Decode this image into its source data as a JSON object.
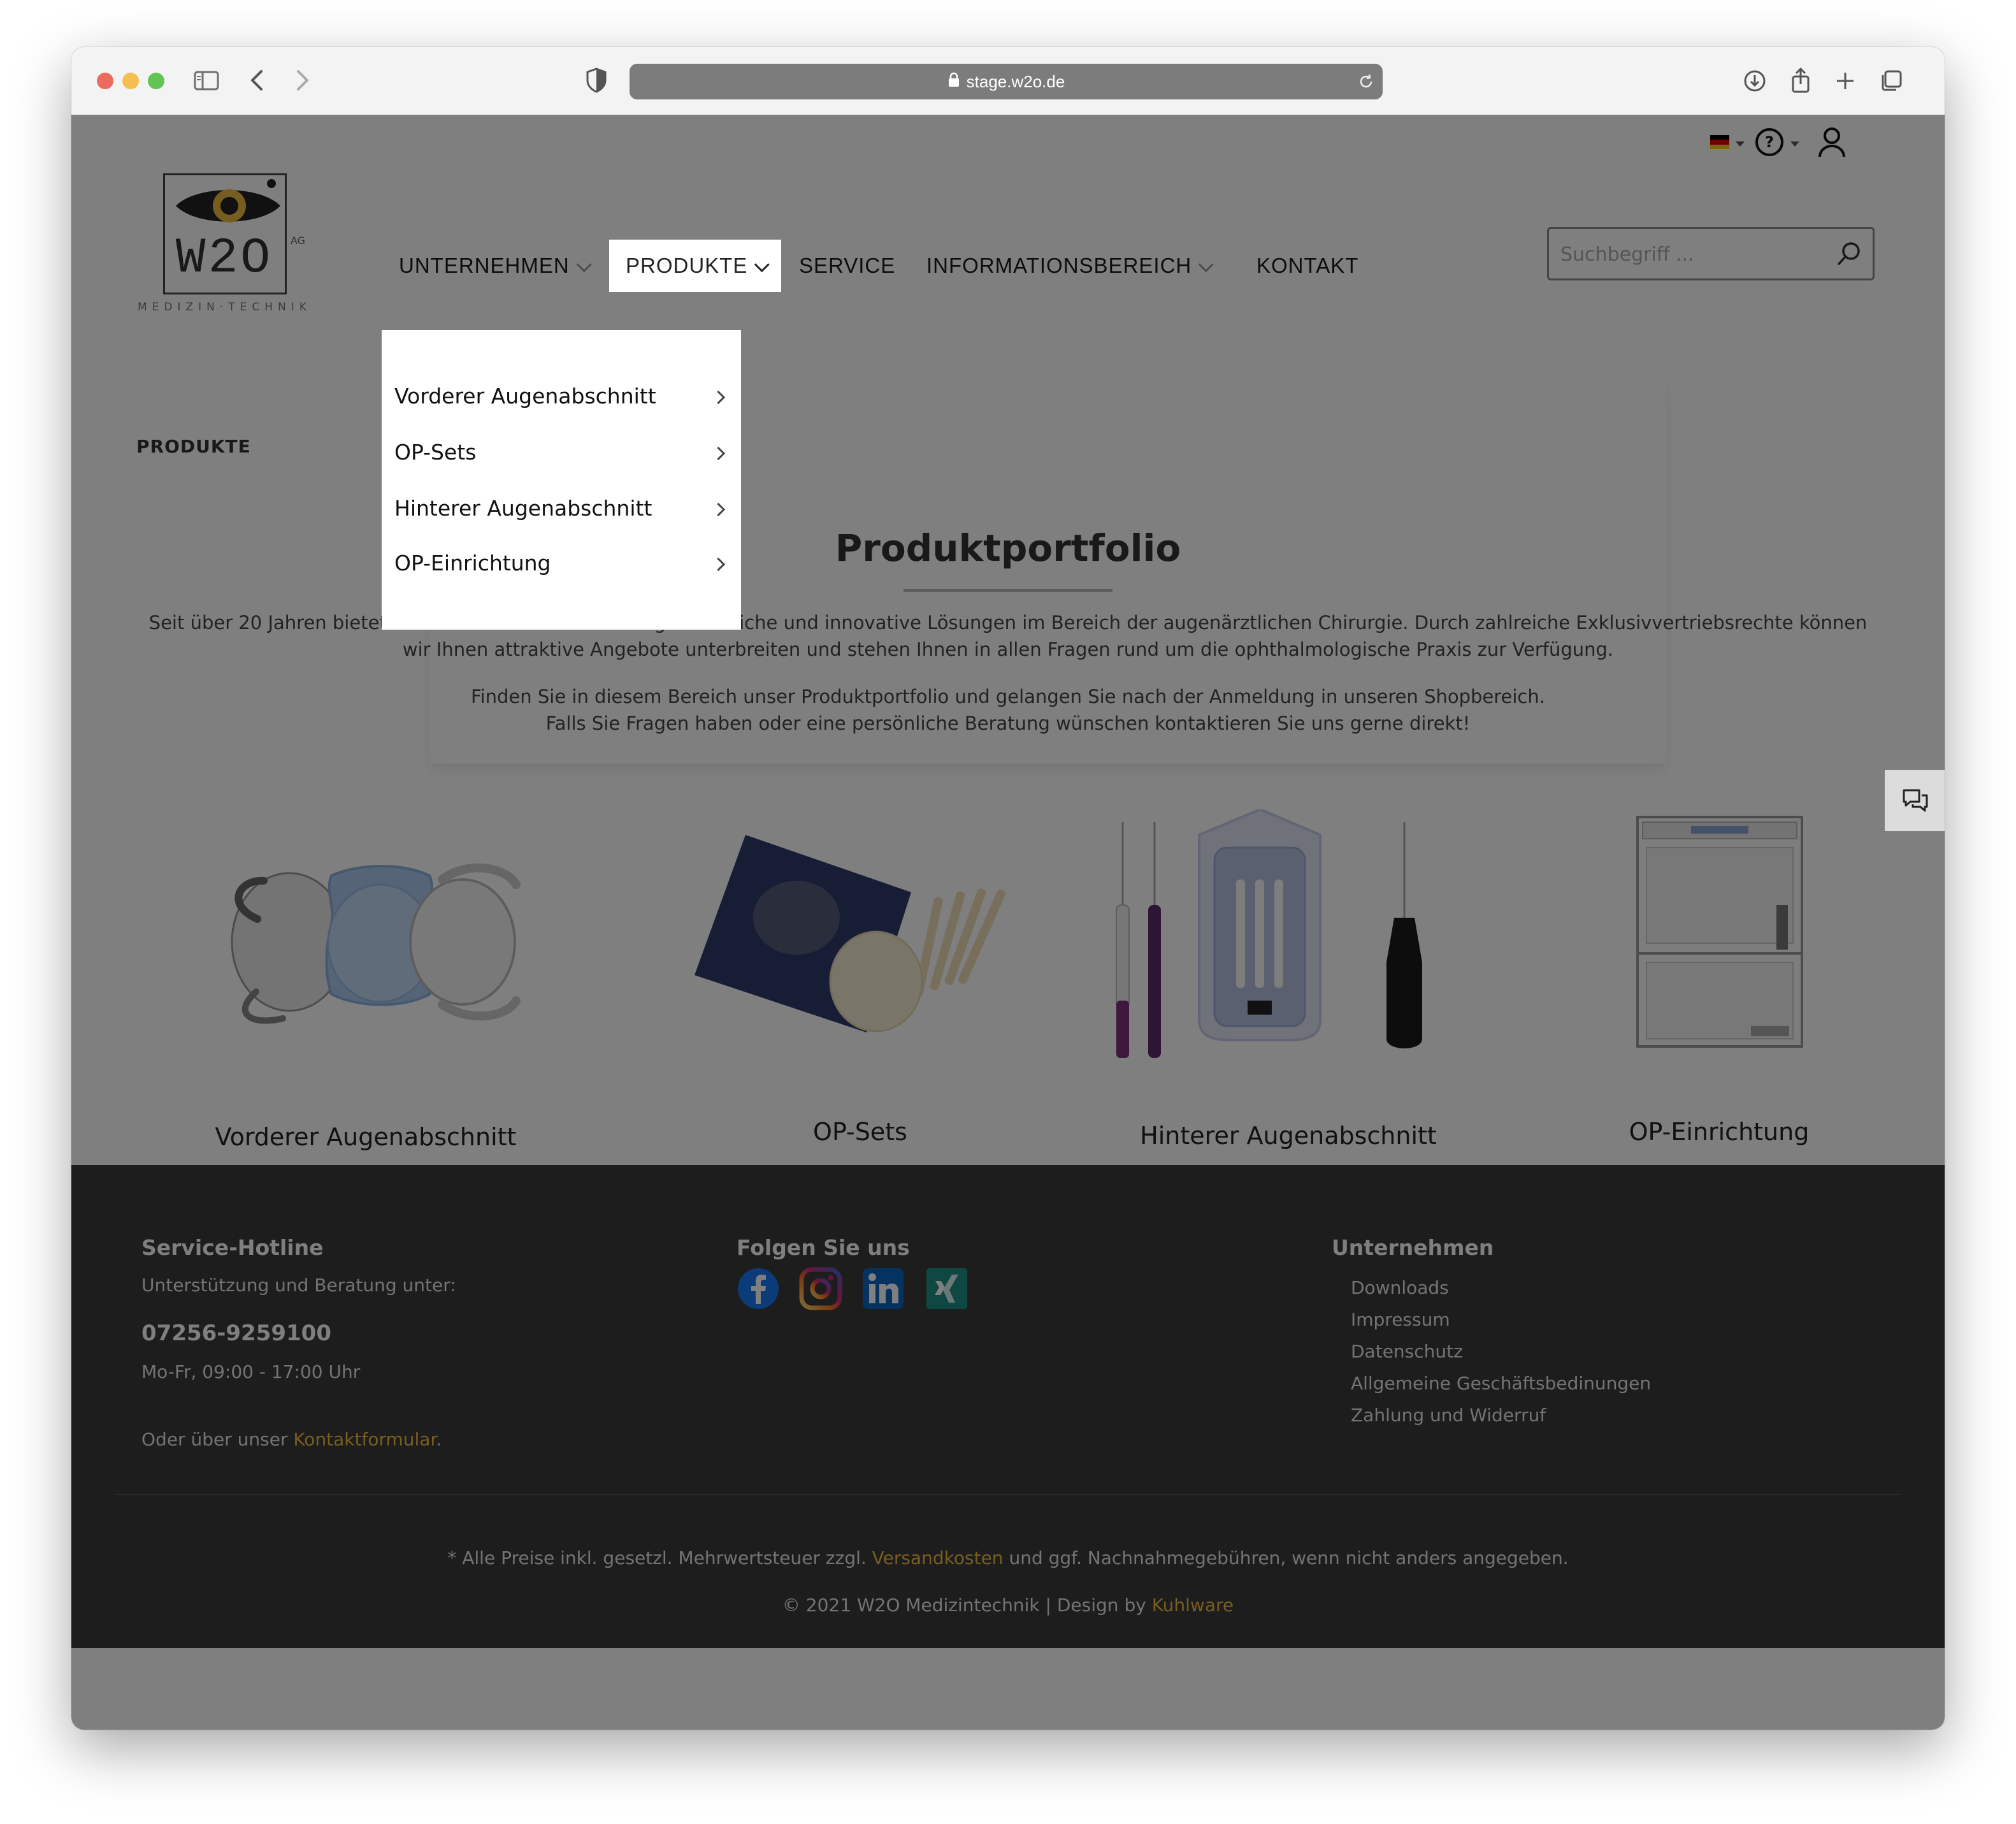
{
  "browser": {
    "url": "stage.w2o.de"
  },
  "logo": {
    "mark": "W2O",
    "suffix": "AG",
    "tagline": "MEDIZIN·TECHNIK"
  },
  "nav": {
    "items": [
      {
        "label": "UNTERNEHMEN"
      },
      {
        "label": "PRODUKTE"
      },
      {
        "label": "SERVICE"
      },
      {
        "label": "INFORMATIONSBEREICH"
      },
      {
        "label": "KONTAKT"
      }
    ]
  },
  "search": {
    "placeholder": "Suchbegriff ..."
  },
  "dropdown": {
    "items": [
      {
        "label": "Vorderer Augenabschnitt"
      },
      {
        "label": "OP-Sets"
      },
      {
        "label": "Hinterer Augenabschnitt"
      },
      {
        "label": "OP-Einrichtung"
      }
    ]
  },
  "page": {
    "breadcrumb": "PRODUKTE",
    "title": "Produktportfolio",
    "intro1_line1": "Seit über 20 Jahren bietet die W2O Medizintechnik AG ganzheitliche und innovative Lösungen im Bereich der augenärztlichen Chirurgie. Durch zahlreiche Exklusivvertriebsrechte können",
    "intro1_line2": "wir Ihnen attraktive Angebote unterbreiten und stehen Ihnen in allen Fragen rund um die ophthalmologische Praxis zur Verfügung.",
    "intro2_line1": "Finden Sie in diesem Bereich unser Produktportfolio und gelangen Sie nach der Anmeldung in unseren Shopbereich.",
    "intro2_line2": "Falls Sie Fragen haben oder eine persönliche Beratung wünschen kontaktieren Sie uns gerne direkt!"
  },
  "products": [
    {
      "label": "Vorderer Augenabschnitt"
    },
    {
      "label": "OP-Sets"
    },
    {
      "label": "Hinterer Augenabschnitt"
    },
    {
      "label": "OP-Einrichtung"
    }
  ],
  "footer": {
    "hotline_heading": "Service-Hotline",
    "hotline_sub": "Unterstützung und Beratung unter:",
    "phone": "07256-9259100",
    "hours": "Mo-Fr, 09:00 - 17:00 Uhr",
    "contact_prefix": "Oder über unser ",
    "contact_link": "Kontaktformular",
    "contact_suffix": ".",
    "social_heading": "Folgen Sie uns",
    "company_heading": "Unternehmen",
    "company_links": [
      {
        "label": "Downloads"
      },
      {
        "label": "Impressum"
      },
      {
        "label": "Datenschutz"
      },
      {
        "label": "Allgemeine Geschäftsbedinungen"
      },
      {
        "label": "Zahlung und Widerruf"
      }
    ],
    "prices_prefix": "* Alle Preise inkl. gesetzl. Mehrwertsteuer zzgl. ",
    "prices_link": "Versandkosten",
    "prices_suffix": " und ggf. Nachnahmegebühren, wenn nicht anders angegeben.",
    "copyright_prefix": "© 2021 W2O Medizintechnik | Design by ",
    "copyright_link": "Kuhlware"
  },
  "colors": {
    "accent": "#f0ba42",
    "footer_bg": "#3a3a3a",
    "overlay": "#000000"
  },
  "icons": [
    "sidebar-icon",
    "back-icon",
    "forward-icon",
    "shield-icon",
    "lock-icon",
    "reload-icon",
    "download-icon",
    "share-icon",
    "plus-icon",
    "tabs-icon",
    "flag-de-icon",
    "help-icon",
    "user-icon",
    "search-icon",
    "chat-icon",
    "facebook-icon",
    "instagram-icon",
    "linkedin-icon",
    "xing-icon"
  ]
}
